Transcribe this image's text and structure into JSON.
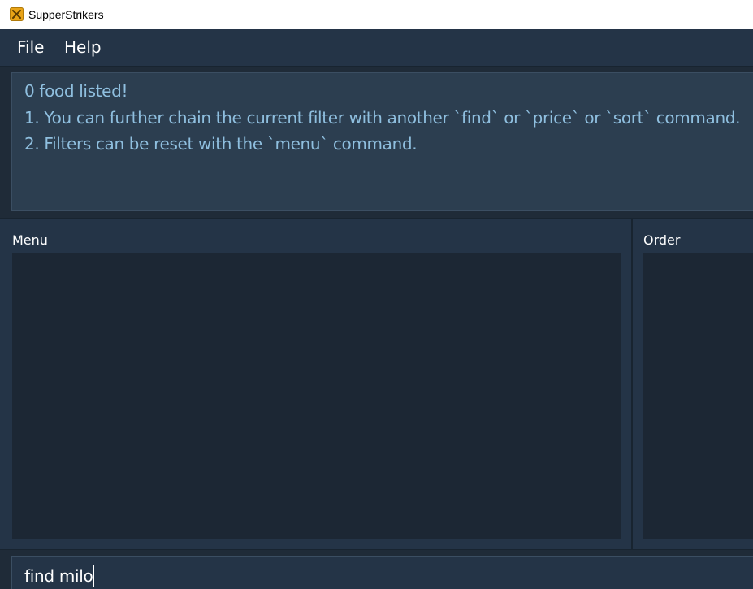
{
  "window": {
    "title": "SupperStrikers"
  },
  "menubar": {
    "items": [
      {
        "label": "File"
      },
      {
        "label": "Help"
      }
    ]
  },
  "result_display": {
    "lines": [
      "0 food listed!",
      "1. You can further chain the current filter with another `find` or `price` or `sort` command.",
      "2. Filters can be reset with the `menu` command."
    ]
  },
  "panels": {
    "menu": {
      "label": "Menu",
      "items": []
    },
    "order": {
      "label": "Order",
      "items": []
    }
  },
  "command_box": {
    "value": "find milo"
  },
  "colors": {
    "background": "#1f2b38",
    "panel": "#243447",
    "result_text": "#8fbfdf",
    "icon_accent": "#e8a317"
  },
  "icons": {
    "app": "app-logo-icon"
  }
}
